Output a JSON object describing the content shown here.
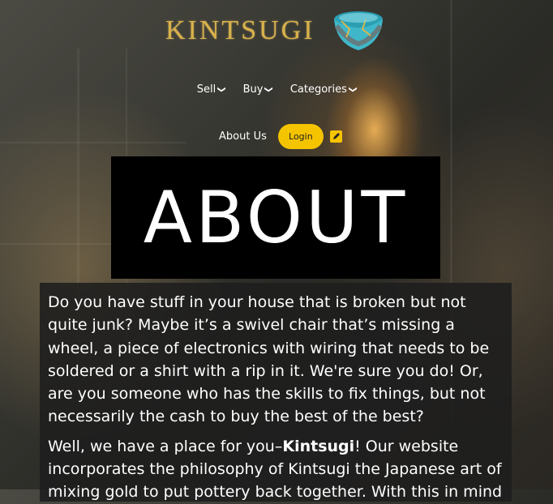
{
  "brand": {
    "logo_text": "KINTSUGI"
  },
  "nav": {
    "items": [
      {
        "label": "Sell"
      },
      {
        "label": "Buy"
      },
      {
        "label": "Categories"
      }
    ],
    "about_label": "About Us",
    "login_label": "Login"
  },
  "hero": {
    "title": "ABOUT"
  },
  "content": {
    "para1": "Do you have stuff in your house that is broken but not quite junk? Maybe it’s a swivel chair that’s missing a wheel, a piece of electronics with wiring that needs to be soldered or a shirt with a rip in it. We're sure you do! Or, are you someone who has the skills to fix things, but not necessarily the cash to buy the best of the best?",
    "para2_prefix": "Well, we have a place for you–",
    "para2_brand": "Kintsugi",
    "para2_suffix": "! Our website incorporates the philosophy of Kintsugi the Japanese art of mixing gold to put pottery back together. With this in mind"
  },
  "colors": {
    "accent": "#f5c400",
    "logo_gold": "#d9b24a",
    "bowl_teal": "#3fb7c9"
  }
}
